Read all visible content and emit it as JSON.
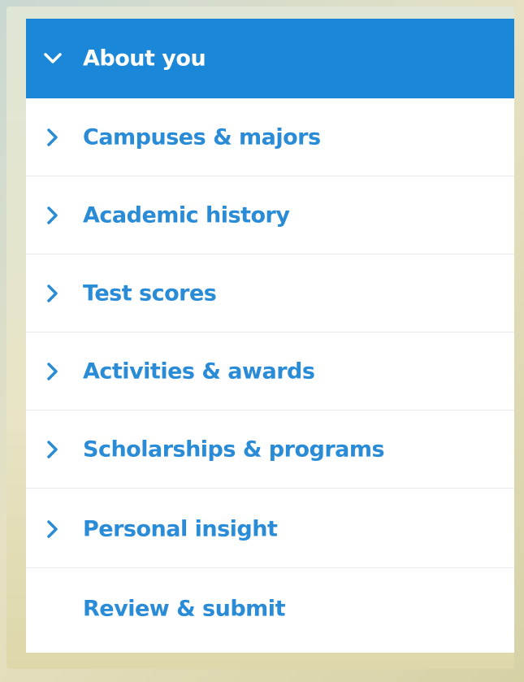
{
  "colors": {
    "accent": "#1a87d8",
    "link": "#2a8bd6",
    "active_text": "#ffffff",
    "panel_bg": "#ffffff"
  },
  "nav": {
    "items": [
      {
        "label": "About you",
        "icon": "chevron-down-icon",
        "active": true
      },
      {
        "label": "Campuses & majors",
        "icon": "chevron-right-icon",
        "active": false
      },
      {
        "label": "Academic history",
        "icon": "chevron-right-icon",
        "active": false
      },
      {
        "label": "Test scores",
        "icon": "chevron-right-icon",
        "active": false
      },
      {
        "label": "Activities & awards",
        "icon": "chevron-right-icon",
        "active": false
      },
      {
        "label": "Scholarships & programs",
        "icon": "chevron-right-icon",
        "active": false
      },
      {
        "label": "Personal insight",
        "icon": "chevron-right-icon",
        "active": false
      },
      {
        "label": "Review & submit",
        "icon": null,
        "active": false
      }
    ]
  }
}
